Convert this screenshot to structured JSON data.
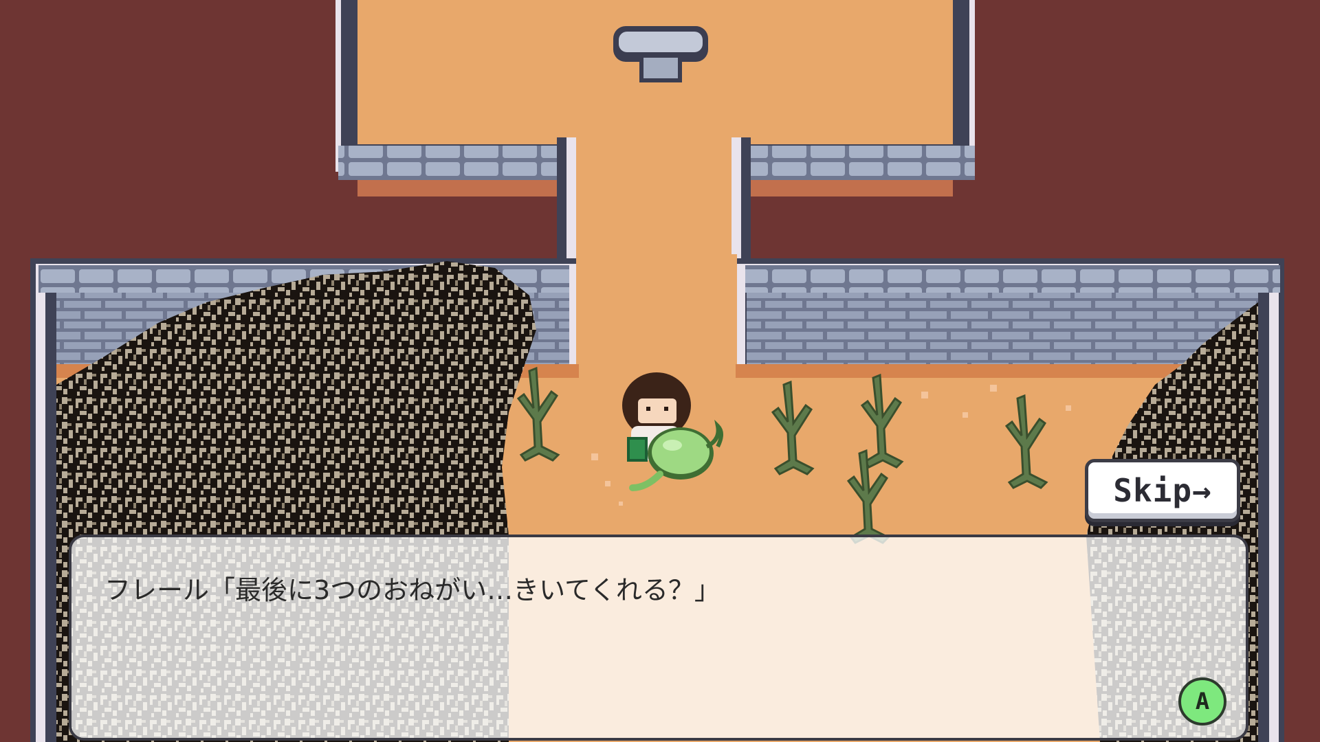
{
  "skip_button": {
    "label": "Skip→"
  },
  "dialogue": {
    "text": "フレール「最後に3つのおねがい…きいてくれる？」",
    "advance_button_label": "A"
  },
  "colors": {
    "outer_wall": "#6e3533",
    "floor": "#e8a86b",
    "stone": "#8d97ae",
    "advance_button": "#7ee87e"
  }
}
